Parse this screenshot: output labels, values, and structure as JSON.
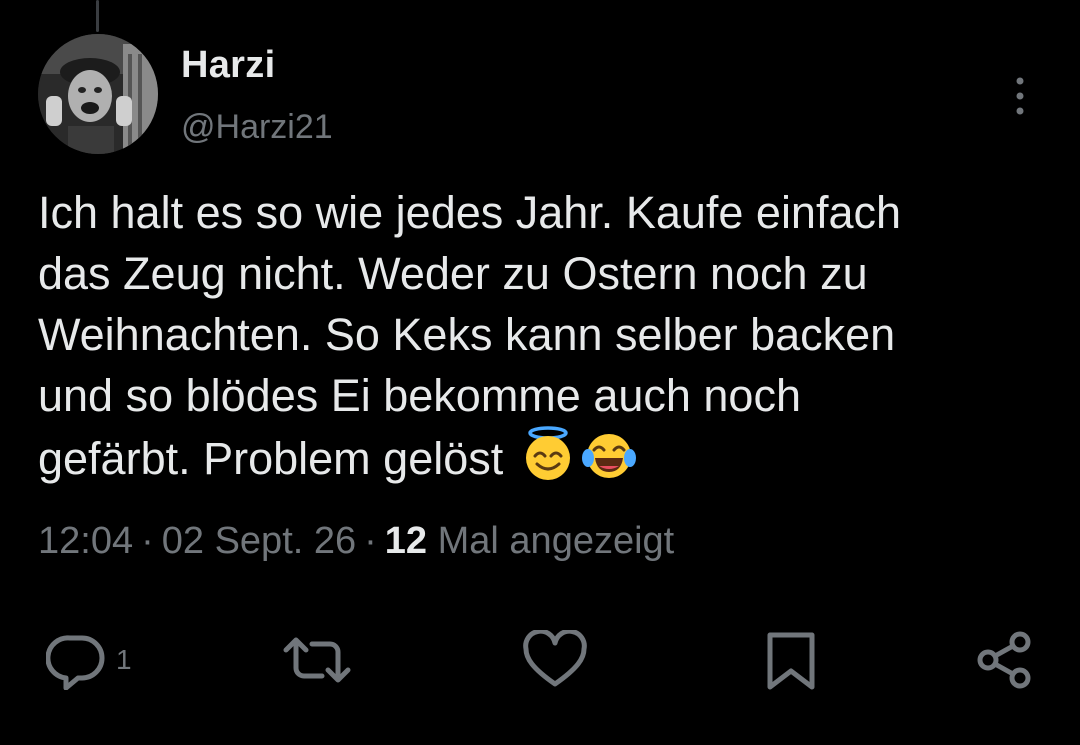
{
  "author": {
    "display_name": "Harzi",
    "handle": "@Harzi21"
  },
  "tweet": {
    "text": "Ich halt es so wie jedes Jahr. Kaufe einfach\ndas Zeug nicht. Weder zu Ostern noch zu\nWeihnachten. So Keks kann selber backen\nund so blödes Ei bekomme auch noch\ngefärbt. Problem gelöst ",
    "emojis": [
      "smiling-face-with-halo",
      "face-with-tears-of-joy"
    ]
  },
  "meta": {
    "time": "12:04",
    "separator": "·",
    "date": "02 Sept. 26",
    "views_count": "12",
    "views_label": " Mal angezeigt"
  },
  "actions": {
    "reply_count": "1",
    "icons": [
      "reply-icon",
      "retweet-icon",
      "like-icon",
      "bookmark-icon",
      "share-icon"
    ]
  },
  "colors": {
    "background": "#000000",
    "text_primary": "#e7e9ea",
    "text_secondary": "#71767b"
  }
}
